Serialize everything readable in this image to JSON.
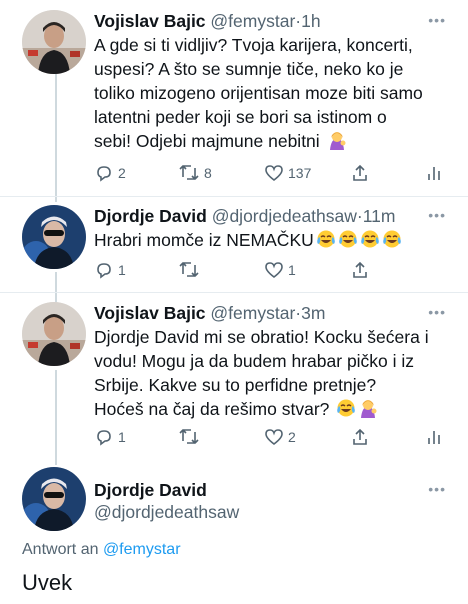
{
  "tweets": [
    {
      "name": "Vojislav Bajic",
      "handle": "@femystar",
      "separator": "·",
      "time": "1h",
      "text_lines": [
        "A gde si ti vidljiv? Tvoja karijera, koncerti,",
        "uspesi? A što se sumnje tiče, neko ko je",
        "toliko mizogeno orijentisan moze biti samo",
        "latentni peder koji se bori sa istinom o",
        "sebi! Odjebi majmune nebitni"
      ],
      "emojis": [
        "woman-tipping-hand-emoji"
      ],
      "replies": "2",
      "retweets": "8",
      "likes": "137"
    },
    {
      "name": "Djordje David",
      "handle": "@djordjedeathsaw",
      "separator": "·",
      "time": "11m",
      "text_lines": [
        "Hrabri momče iz NEMAČKU"
      ],
      "emojis": [
        "tears-of-joy-emoji",
        "tears-of-joy-emoji",
        "tears-of-joy-emoji",
        "tears-of-joy-emoji"
      ],
      "replies": "1",
      "retweets": "",
      "likes": "1"
    },
    {
      "name": "Vojislav Bajic",
      "handle": "@femystar",
      "separator": "·",
      "time": "3m",
      "text_lines": [
        "Djordje David mi se obratio! Kocku šećera i",
        "vodu! Mogu ja da budem hrabar pičko i iz",
        "Srbije. Kakve su to perfidne pretnje?",
        "Hoćeš na čaj da rešimo stvar?"
      ],
      "emojis": [
        "tears-of-joy-emoji",
        "woman-tipping-hand-emoji"
      ],
      "replies": "1",
      "retweets": "",
      "likes": "2"
    }
  ],
  "compose": {
    "name": "Djordje David",
    "handle": "@djordjedeathsaw",
    "reply_prefix": "Antwort an",
    "reply_mention": "@femystar",
    "text": "Uvek"
  },
  "colors": {
    "text": "#0f1419",
    "secondary": "#536471",
    "link": "#1d9bf0",
    "divider": "#e6ecf0"
  }
}
